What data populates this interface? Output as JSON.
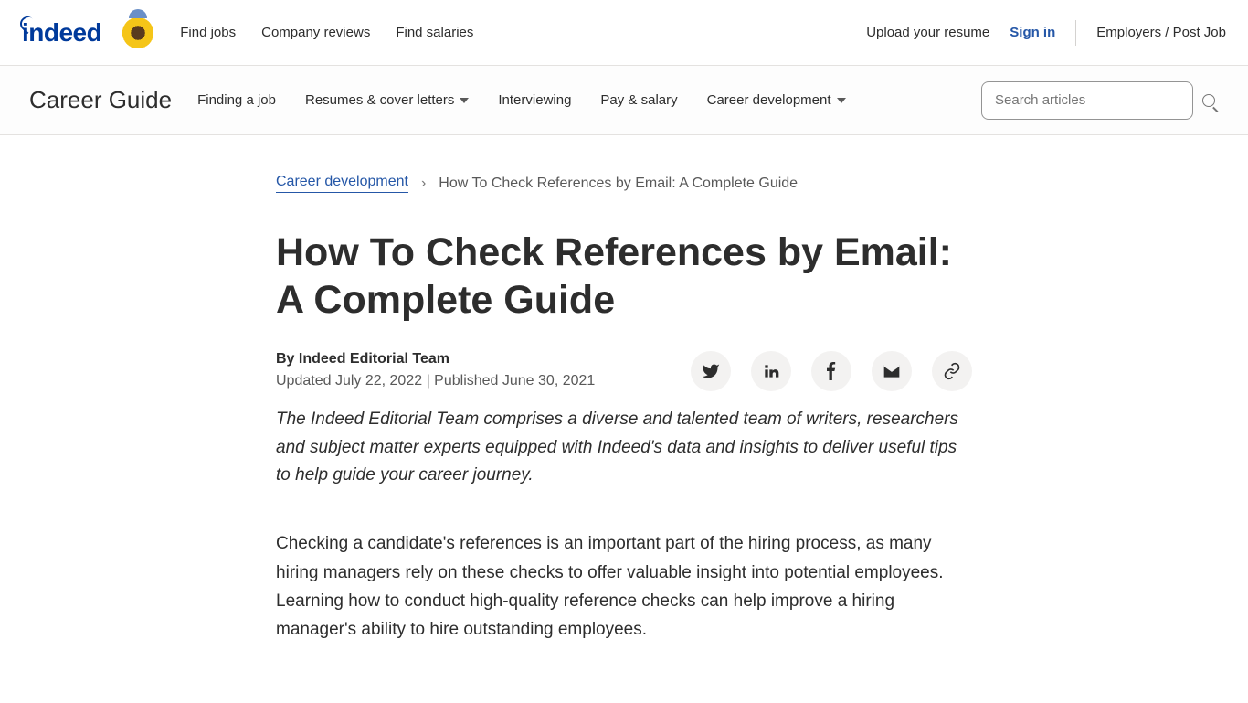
{
  "header": {
    "logo_text": "indeed",
    "nav": [
      "Find jobs",
      "Company reviews",
      "Find salaries"
    ],
    "upload": "Upload your resume",
    "signin": "Sign in",
    "employers": "Employers / Post Job"
  },
  "subheader": {
    "title": "Career Guide",
    "nav": [
      {
        "label": "Finding a job",
        "dropdown": false
      },
      {
        "label": "Resumes & cover letters",
        "dropdown": true
      },
      {
        "label": "Interviewing",
        "dropdown": false
      },
      {
        "label": "Pay & salary",
        "dropdown": false
      },
      {
        "label": "Career development",
        "dropdown": true
      }
    ],
    "search_placeholder": "Search articles"
  },
  "breadcrumb": {
    "parent": "Career development",
    "current": "How To Check References by Email: A Complete Guide"
  },
  "article": {
    "title": "How To Check References by Email: A Complete Guide",
    "byline": "By Indeed Editorial Team",
    "dates": "Updated July 22, 2022 | Published June 30, 2021",
    "intro": "The Indeed Editorial Team comprises a diverse and talented team of writers, researchers and subject matter experts equipped with Indeed's data and insights to deliver useful tips to help guide your career journey.",
    "body1": "Checking a candidate's references is an important part of the hiring process, as many hiring managers rely on these checks to offer valuable insight into potential employees. Learning how to conduct high-quality reference checks can help improve a hiring manager's ability to hire outstanding employees."
  }
}
